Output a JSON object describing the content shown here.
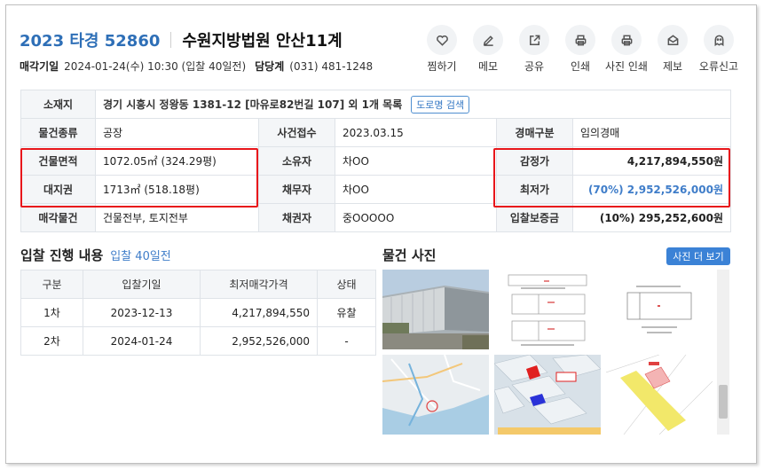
{
  "header": {
    "case_number": "2023 타경 52860",
    "court": "수원지방법원 안산11계",
    "sale_date_label": "매각기일",
    "sale_date_value": "2024-01-24(수) 10:30 (입찰 40일전)",
    "manager_label": "담당계",
    "manager_value": "(031) 481-1248"
  },
  "actions": [
    {
      "label": "찜하기",
      "icon": "heart-icon"
    },
    {
      "label": "메모",
      "icon": "pencil-icon"
    },
    {
      "label": "공유",
      "icon": "share-icon"
    },
    {
      "label": "인쇄",
      "icon": "print-icon"
    },
    {
      "label": "사진 인쇄",
      "icon": "print-icon"
    },
    {
      "label": "제보",
      "icon": "mail-icon"
    },
    {
      "label": "오류신고",
      "icon": "ghost-icon"
    }
  ],
  "info": {
    "location_label": "소재지",
    "location_value": "경기 시흥시 정왕동 1381-12 [마유로82번길 107] 외 1개 목록",
    "road_search": "도로명 검색",
    "type_label": "물건종류",
    "type_value": "공장",
    "case_received_label": "사건접수",
    "case_received_value": "2023.03.15",
    "auction_type_label": "경매구분",
    "auction_type_value": "임의경매",
    "building_area_label": "건물면적",
    "building_area_value": "1072.05㎡ (324.29평)",
    "owner_label": "소유자",
    "owner_value": "차OO",
    "appraisal_label": "감정가",
    "appraisal_value": "4,217,894,550원",
    "land_right_label": "대지권",
    "land_right_value": "1713㎡ (518.18평)",
    "debtor_label": "채무자",
    "debtor_value": "차OO",
    "min_price_label": "최저가",
    "min_price_value": "(70%) 2,952,526,000원",
    "sale_object_label": "매각물건",
    "sale_object_value": "건물전부, 토지전부",
    "creditor_label": "채권자",
    "creditor_value": "중OOOOO",
    "deposit_label": "입찰보증금",
    "deposit_value": "(10%) 295,252,600원"
  },
  "bid_progress": {
    "title": "입찰 진행 내용",
    "subtitle": "입찰 40일전",
    "columns": [
      "구분",
      "입찰기일",
      "최저매각가격",
      "상태"
    ],
    "rows": [
      [
        "1차",
        "2023-12-13",
        "4,217,894,550",
        "유찰"
      ],
      [
        "2차",
        "2024-01-24",
        "2,952,526,000",
        "-"
      ]
    ]
  },
  "photos": {
    "title": "물건 사진",
    "more_button": "사진 더 보기"
  },
  "colors": {
    "accent_blue": "#2e6fb7",
    "highlight_red": "#e8161b",
    "button_blue": "#3b82d6"
  }
}
